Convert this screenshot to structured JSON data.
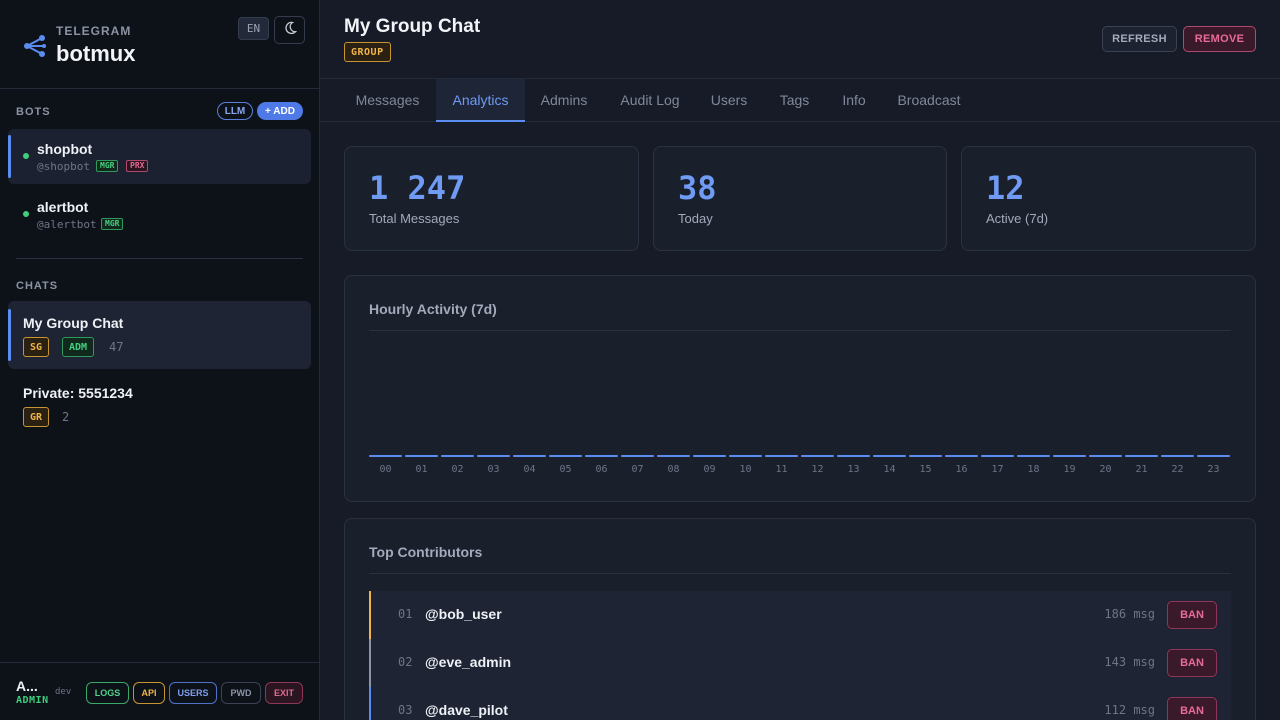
{
  "brand": {
    "kicker": "TELEGRAM",
    "name": "botmux",
    "lang": "EN"
  },
  "bots": {
    "section_label": "BOTS",
    "llm_label": "LLM",
    "add_label": "+ ADD",
    "items": [
      {
        "name": "shopbot",
        "handle": "@shopbot",
        "tags": [
          "MGR",
          "PRX"
        ],
        "active": true,
        "status_color": "#3ecf7d"
      },
      {
        "name": "alertbot",
        "handle": "@alertbot",
        "tags": [
          "MGR"
        ],
        "active": false,
        "status_color": "#3ecf7d"
      }
    ]
  },
  "chats": {
    "section_label": "CHATS",
    "items": [
      {
        "name": "My Group Chat",
        "tags": [
          "SG",
          "ADM"
        ],
        "count": "47",
        "active": true
      },
      {
        "name": "Private: 5551234",
        "tags": [
          "GR"
        ],
        "count": "2",
        "active": false
      }
    ]
  },
  "footer": {
    "user": "A...",
    "role": "ADMIN",
    "env": "dev",
    "buttons": {
      "logs": "LOGS",
      "api": "API",
      "users": "USERS",
      "pwd": "PWD",
      "exit": "EXIT"
    }
  },
  "header": {
    "title": "My Group Chat",
    "type_badge": "GROUP",
    "refresh_label": "REFRESH",
    "remove_label": "REMOVE"
  },
  "tabs": [
    {
      "label": "Messages",
      "active": false
    },
    {
      "label": "Analytics",
      "active": true
    },
    {
      "label": "Admins",
      "active": false
    },
    {
      "label": "Audit Log",
      "active": false
    },
    {
      "label": "Users",
      "active": false
    },
    {
      "label": "Tags",
      "active": false
    },
    {
      "label": "Info",
      "active": false
    },
    {
      "label": "Broadcast",
      "active": false
    }
  ],
  "stats": [
    {
      "value": "1 247",
      "label": "Total Messages"
    },
    {
      "value": "38",
      "label": "Today"
    },
    {
      "value": "12",
      "label": "Active (7d)"
    }
  ],
  "hourly": {
    "title": "Hourly Activity (7d)",
    "hours": [
      "00",
      "01",
      "02",
      "03",
      "04",
      "05",
      "06",
      "07",
      "08",
      "09",
      "10",
      "11",
      "12",
      "13",
      "14",
      "15",
      "16",
      "17",
      "18",
      "19",
      "20",
      "21",
      "22",
      "23"
    ],
    "values": [
      0,
      0,
      0,
      0,
      0,
      0,
      0,
      0,
      0,
      0,
      0,
      0,
      0,
      0,
      0,
      0,
      0,
      0,
      0,
      0,
      0,
      0,
      0,
      0
    ],
    "bar_color": "#5b8df0"
  },
  "contributors": {
    "title": "Top Contributors",
    "unit": "msg",
    "ban_label": "BAN",
    "items": [
      {
        "rank": "01",
        "handle": "@bob_user",
        "count": "186 msg",
        "accent": "#f0b44a"
      },
      {
        "rank": "02",
        "handle": "@eve_admin",
        "count": "143 msg",
        "accent": "#8b93a5"
      },
      {
        "rank": "03",
        "handle": "@dave_pilot",
        "count": "112 msg",
        "accent": "#5b8df0"
      }
    ]
  },
  "icons": {
    "brand": "share-nodes-icon",
    "theme": "moon-icon"
  }
}
